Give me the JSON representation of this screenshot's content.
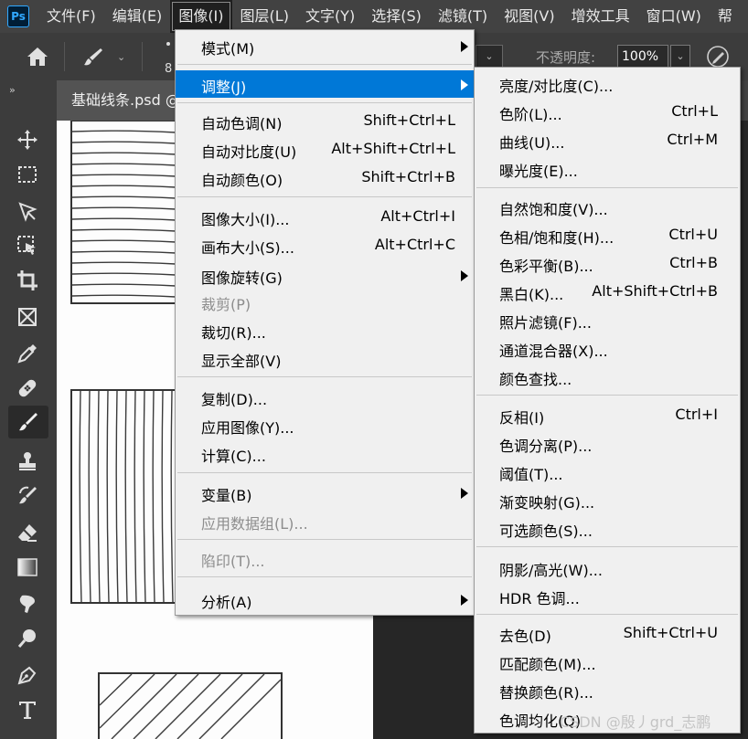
{
  "app": {
    "logo_text": "Ps",
    "menubar": [
      "文件(F)",
      "编辑(E)",
      "图像(I)",
      "图层(L)",
      "文字(Y)",
      "选择(S)",
      "滤镜(T)",
      "视图(V)",
      "增效工具",
      "窗口(W)",
      "帮"
    ],
    "active_menu": "图像(I)"
  },
  "options_bar": {
    "brush_size": "8",
    "opacity_label": "不透明度:",
    "opacity_value": "100%"
  },
  "document_tab": {
    "title": "基础线条.psd @"
  },
  "toolbar": {
    "collapse_label": "››",
    "tools": [
      "move-tool",
      "marquee-tool",
      "lasso-tool",
      "object-select-tool",
      "crop-tool",
      "frame-tool",
      "eyedropper-tool",
      "healing-brush-tool",
      "brush-tool",
      "stamp-tool",
      "history-brush-tool",
      "eraser-tool",
      "gradient-tool",
      "smudge-tool",
      "dodge-tool",
      "pen-tool",
      "type-tool"
    ],
    "selected_tool": "brush-tool"
  },
  "image_menu": {
    "items": [
      {
        "label": "模式(M)",
        "shortcut": "",
        "submenu": true,
        "disabled": false,
        "highlighted": false
      },
      {
        "label": "调整(J)",
        "shortcut": "",
        "submenu": true,
        "disabled": false,
        "highlighted": true
      },
      {
        "label": "自动色调(N)",
        "shortcut": "Shift+Ctrl+L",
        "submenu": false,
        "disabled": false,
        "highlighted": false
      },
      {
        "label": "自动对比度(U)",
        "shortcut": "Alt+Shift+Ctrl+L",
        "submenu": false,
        "disabled": false,
        "highlighted": false
      },
      {
        "label": "自动颜色(O)",
        "shortcut": "Shift+Ctrl+B",
        "submenu": false,
        "disabled": false,
        "highlighted": false
      },
      {
        "label": "图像大小(I)...",
        "shortcut": "Alt+Ctrl+I",
        "submenu": false,
        "disabled": false,
        "highlighted": false
      },
      {
        "label": "画布大小(S)...",
        "shortcut": "Alt+Ctrl+C",
        "submenu": false,
        "disabled": false,
        "highlighted": false
      },
      {
        "label": "图像旋转(G)",
        "shortcut": "",
        "submenu": true,
        "disabled": false,
        "highlighted": false
      },
      {
        "label": "裁剪(P)",
        "shortcut": "",
        "submenu": false,
        "disabled": true,
        "highlighted": false
      },
      {
        "label": "裁切(R)...",
        "shortcut": "",
        "submenu": false,
        "disabled": false,
        "highlighted": false
      },
      {
        "label": "显示全部(V)",
        "shortcut": "",
        "submenu": false,
        "disabled": false,
        "highlighted": false
      },
      {
        "label": "复制(D)...",
        "shortcut": "",
        "submenu": false,
        "disabled": false,
        "highlighted": false
      },
      {
        "label": "应用图像(Y)...",
        "shortcut": "",
        "submenu": false,
        "disabled": false,
        "highlighted": false
      },
      {
        "label": "计算(C)...",
        "shortcut": "",
        "submenu": false,
        "disabled": false,
        "highlighted": false
      },
      {
        "label": "变量(B)",
        "shortcut": "",
        "submenu": true,
        "disabled": false,
        "highlighted": false
      },
      {
        "label": "应用数据组(L)...",
        "shortcut": "",
        "submenu": false,
        "disabled": true,
        "highlighted": false
      },
      {
        "label": "陷印(T)...",
        "shortcut": "",
        "submenu": false,
        "disabled": true,
        "highlighted": false
      },
      {
        "label": "分析(A)",
        "shortcut": "",
        "submenu": true,
        "disabled": false,
        "highlighted": false
      }
    ]
  },
  "adjust_submenu": {
    "items": [
      {
        "label": "亮度/对比度(C)...",
        "shortcut": ""
      },
      {
        "label": "色阶(L)...",
        "shortcut": "Ctrl+L"
      },
      {
        "label": "曲线(U)...",
        "shortcut": "Ctrl+M"
      },
      {
        "label": "曝光度(E)...",
        "shortcut": ""
      },
      {
        "label": "自然饱和度(V)...",
        "shortcut": ""
      },
      {
        "label": "色相/饱和度(H)...",
        "shortcut": "Ctrl+U"
      },
      {
        "label": "色彩平衡(B)...",
        "shortcut": "Ctrl+B"
      },
      {
        "label": "黑白(K)...",
        "shortcut": "Alt+Shift+Ctrl+B"
      },
      {
        "label": "照片滤镜(F)...",
        "shortcut": ""
      },
      {
        "label": "通道混合器(X)...",
        "shortcut": ""
      },
      {
        "label": "颜色查找...",
        "shortcut": ""
      },
      {
        "label": "反相(I)",
        "shortcut": "Ctrl+I"
      },
      {
        "label": "色调分离(P)...",
        "shortcut": ""
      },
      {
        "label": "阈值(T)...",
        "shortcut": ""
      },
      {
        "label": "渐变映射(G)...",
        "shortcut": ""
      },
      {
        "label": "可选颜色(S)...",
        "shortcut": ""
      },
      {
        "label": "阴影/高光(W)...",
        "shortcut": ""
      },
      {
        "label": "HDR 色调...",
        "shortcut": ""
      },
      {
        "label": "去色(D)",
        "shortcut": "Shift+Ctrl+U"
      },
      {
        "label": "匹配颜色(M)...",
        "shortcut": ""
      },
      {
        "label": "替换颜色(R)...",
        "shortcut": ""
      },
      {
        "label": "色调均化(Q)",
        "shortcut": ""
      }
    ]
  },
  "watermark": "CSDN @殷丿grd_志鹏"
}
